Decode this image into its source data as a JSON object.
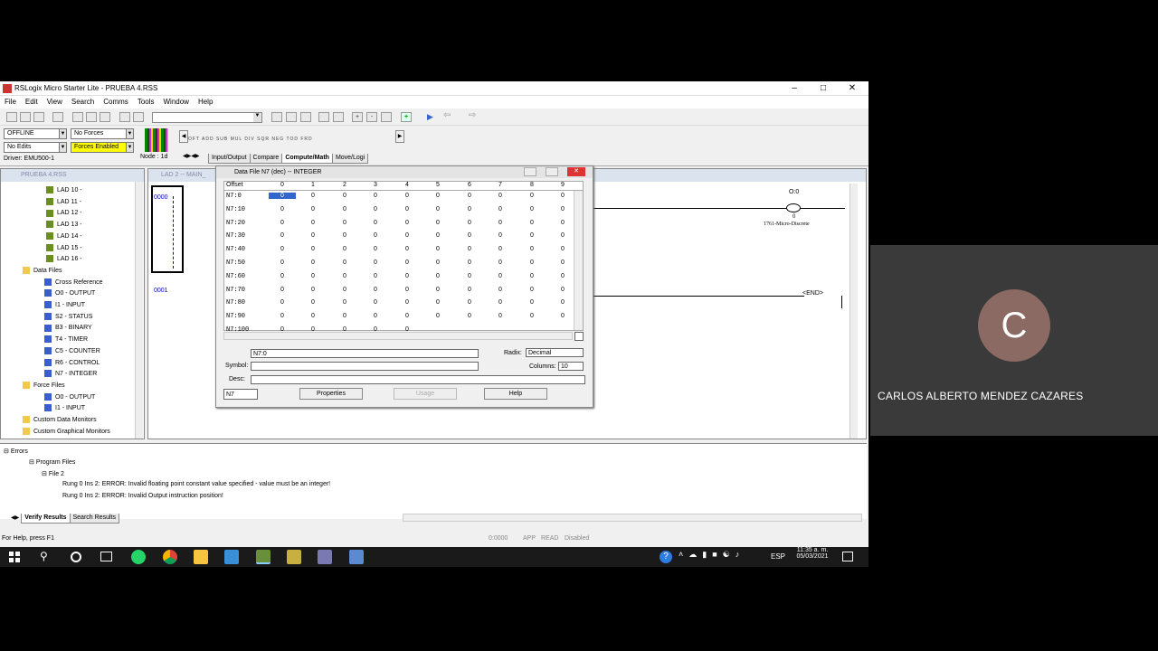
{
  "app": {
    "title": "RSLogix Micro Starter Lite - PRUEBA 4.RSS",
    "menu": [
      "File",
      "Edit",
      "View",
      "Search",
      "Comms",
      "Tools",
      "Window",
      "Help"
    ],
    "status": {
      "mode": "OFFLINE",
      "forces": "No Forces",
      "edits": "No Edits",
      "forces_enabled": "Forces Enabled",
      "driver": "Driver: EMU500-1",
      "node": "Node : 1d"
    },
    "instr_tabs": [
      "Input/Output",
      "Compare",
      "Compute/Math",
      "Move/Logi"
    ],
    "instr_strip": "OFT ADD SUB MUL DIV SQR NEG TOD FRD"
  },
  "tree": {
    "title": "PRUEBA 4.RSS",
    "items": [
      {
        "label": "LAD 10 -",
        "depth": 3
      },
      {
        "label": "LAD 11 -",
        "depth": 3
      },
      {
        "label": "LAD 12 -",
        "depth": 3
      },
      {
        "label": "LAD 13 -",
        "depth": 3
      },
      {
        "label": "LAD 14 -",
        "depth": 3
      },
      {
        "label": "LAD 15 -",
        "depth": 3
      },
      {
        "label": "LAD 16 -",
        "depth": 3
      },
      {
        "label": "Data Files",
        "depth": 1
      },
      {
        "label": "Cross Reference",
        "depth": 2
      },
      {
        "label": "O0 - OUTPUT",
        "depth": 2
      },
      {
        "label": "I1 - INPUT",
        "depth": 2
      },
      {
        "label": "S2 - STATUS",
        "depth": 2
      },
      {
        "label": "B3 - BINARY",
        "depth": 2
      },
      {
        "label": "T4 - TIMER",
        "depth": 2
      },
      {
        "label": "C5 - COUNTER",
        "depth": 2
      },
      {
        "label": "R6 - CONTROL",
        "depth": 2
      },
      {
        "label": "N7 - INTEGER",
        "depth": 2
      },
      {
        "label": "Force Files",
        "depth": 1
      },
      {
        "label": "O0 - OUTPUT",
        "depth": 2
      },
      {
        "label": "I1 - INPUT",
        "depth": 2
      },
      {
        "label": "Custom Data Monitors",
        "depth": 1
      },
      {
        "label": "Custom Graphical Monitors",
        "depth": 1
      }
    ]
  },
  "ladder": {
    "title": "LAD 2 -- MAIN_",
    "rung0": "0000",
    "rung1": "0001",
    "output_addr": "O:0",
    "output_bit": "0",
    "output_desc": "1761-Micro-Discrete",
    "end_label": "END"
  },
  "dialog": {
    "title": "Data File N7 (dec)  --  INTEGER",
    "header": [
      "Offset",
      "0",
      "1",
      "2",
      "3",
      "4",
      "5",
      "6",
      "7",
      "8",
      "9"
    ],
    "rows": [
      "N7:0",
      "N7:10",
      "N7:20",
      "N7:30",
      "N7:40",
      "N7:50",
      "N7:60",
      "N7:70",
      "N7:80",
      "N7:90",
      "N7:100"
    ],
    "cell_value": "0",
    "address_value": "N7:0",
    "symbol_label": "Symbol:",
    "desc_label": "Desc:",
    "radix_label": "Radix:",
    "radix_value": "Decimal",
    "columns_label": "Columns:",
    "columns_value": "10",
    "file_value": "N7",
    "properties_btn": "Properties",
    "usage_btn": "Usage",
    "help_btn": "Help"
  },
  "errors": {
    "root": "Errors",
    "program_files": "Program Files",
    "file": "File 2",
    "msg1": "Rung 0 Ins 2: ERROR: Invalid floating point constant value specified - value must be an integer!",
    "msg2": "Rung 0 Ins 2: ERROR: Invalid Output instruction position!",
    "tab1": "Verify Results",
    "tab2": "Search Results"
  },
  "statusbar": {
    "help": "For Help, press F1",
    "addr": "0:0000",
    "app": "APP",
    "read": "READ",
    "disabled": "Disabled"
  },
  "taskbar": {
    "lang": "ESP",
    "time": "11:35 a. m.",
    "date": "05/03/2021"
  },
  "participant": {
    "initial": "C",
    "name": "CARLOS ALBERTO MENDEZ CAZARES"
  }
}
